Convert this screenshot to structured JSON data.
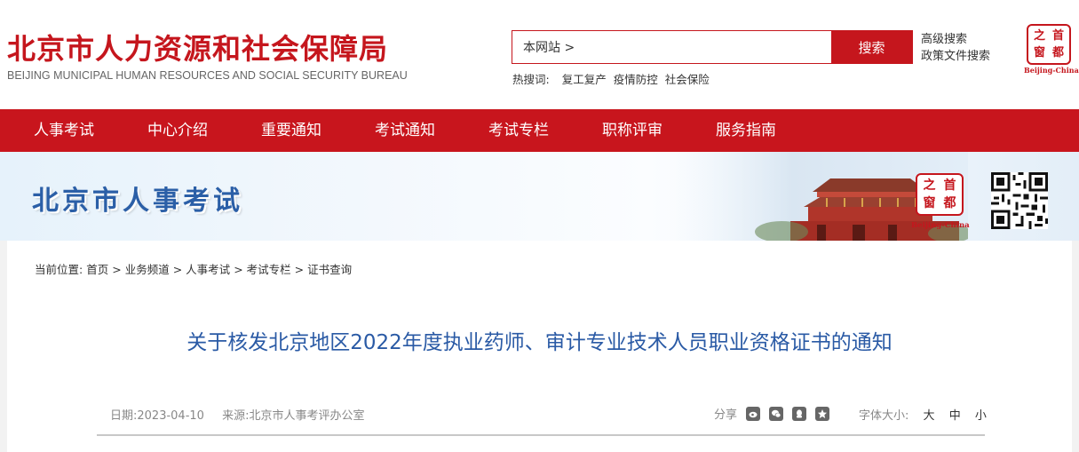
{
  "header": {
    "title": "北京市人力资源和社会保障局",
    "subtitle": "BEIJING MUNICIPAL HUMAN RESOURCES AND SOCIAL SECURITY BUREAU",
    "search_value": "本网站 >",
    "search_button": "搜索",
    "advanced_search": "高级搜索",
    "policy_search": "政策文件搜索",
    "hot_label": "热搜词:",
    "hot_terms": [
      "复工复产",
      "疫情防控",
      "社会保险"
    ],
    "seal": {
      "chars": [
        "之",
        "首",
        "窗",
        "都"
      ],
      "caption": "Beijing-China"
    }
  },
  "nav": {
    "items": [
      "人事考试",
      "中心介绍",
      "重要通知",
      "考试通知",
      "考试专栏",
      "职称评审",
      "服务指南"
    ]
  },
  "banner": {
    "title": "北京市人事考试",
    "seal": {
      "chars": [
        "之",
        "首",
        "窗",
        "都"
      ],
      "caption": "Beijing-China"
    }
  },
  "breadcrumb": {
    "label": "当前位置:",
    "items": [
      "首页",
      "业务频道",
      "人事考试",
      "考试专栏",
      "证书查询"
    ]
  },
  "article": {
    "title": "关于核发北京地区2022年度执业药师、审计专业技术人员职业资格证书的通知",
    "date": "日期:2023-04-10",
    "source": "来源:北京市人事考评办公室",
    "share_label": "分享",
    "font_size_label": "字体大小:",
    "font_sizes": [
      "大",
      "中",
      "小"
    ]
  },
  "colors": {
    "brand_red": "#c8151d",
    "title_blue": "#2a5aa5"
  }
}
